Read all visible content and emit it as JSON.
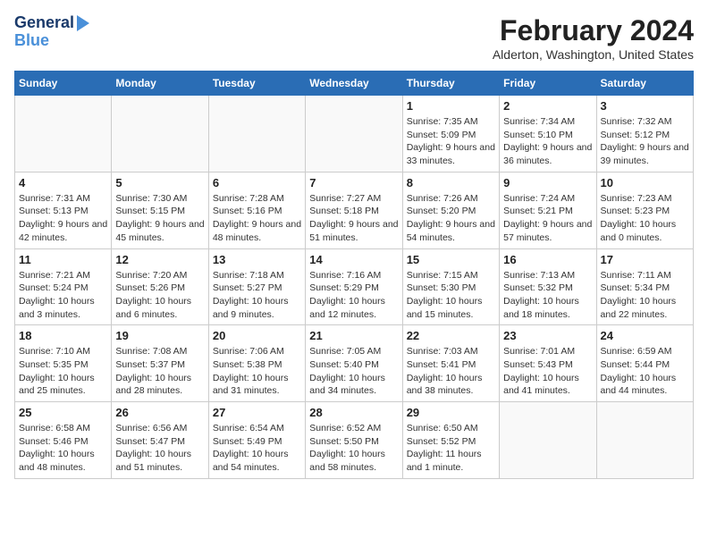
{
  "header": {
    "logo_line1": "General",
    "logo_line2": "Blue",
    "month": "February 2024",
    "location": "Alderton, Washington, United States"
  },
  "weekdays": [
    "Sunday",
    "Monday",
    "Tuesday",
    "Wednesday",
    "Thursday",
    "Friday",
    "Saturday"
  ],
  "weeks": [
    [
      {
        "day": "",
        "info": ""
      },
      {
        "day": "",
        "info": ""
      },
      {
        "day": "",
        "info": ""
      },
      {
        "day": "",
        "info": ""
      },
      {
        "day": "1",
        "info": "Sunrise: 7:35 AM\nSunset: 5:09 PM\nDaylight: 9 hours and 33 minutes."
      },
      {
        "day": "2",
        "info": "Sunrise: 7:34 AM\nSunset: 5:10 PM\nDaylight: 9 hours and 36 minutes."
      },
      {
        "day": "3",
        "info": "Sunrise: 7:32 AM\nSunset: 5:12 PM\nDaylight: 9 hours and 39 minutes."
      }
    ],
    [
      {
        "day": "4",
        "info": "Sunrise: 7:31 AM\nSunset: 5:13 PM\nDaylight: 9 hours and 42 minutes."
      },
      {
        "day": "5",
        "info": "Sunrise: 7:30 AM\nSunset: 5:15 PM\nDaylight: 9 hours and 45 minutes."
      },
      {
        "day": "6",
        "info": "Sunrise: 7:28 AM\nSunset: 5:16 PM\nDaylight: 9 hours and 48 minutes."
      },
      {
        "day": "7",
        "info": "Sunrise: 7:27 AM\nSunset: 5:18 PM\nDaylight: 9 hours and 51 minutes."
      },
      {
        "day": "8",
        "info": "Sunrise: 7:26 AM\nSunset: 5:20 PM\nDaylight: 9 hours and 54 minutes."
      },
      {
        "day": "9",
        "info": "Sunrise: 7:24 AM\nSunset: 5:21 PM\nDaylight: 9 hours and 57 minutes."
      },
      {
        "day": "10",
        "info": "Sunrise: 7:23 AM\nSunset: 5:23 PM\nDaylight: 10 hours and 0 minutes."
      }
    ],
    [
      {
        "day": "11",
        "info": "Sunrise: 7:21 AM\nSunset: 5:24 PM\nDaylight: 10 hours and 3 minutes."
      },
      {
        "day": "12",
        "info": "Sunrise: 7:20 AM\nSunset: 5:26 PM\nDaylight: 10 hours and 6 minutes."
      },
      {
        "day": "13",
        "info": "Sunrise: 7:18 AM\nSunset: 5:27 PM\nDaylight: 10 hours and 9 minutes."
      },
      {
        "day": "14",
        "info": "Sunrise: 7:16 AM\nSunset: 5:29 PM\nDaylight: 10 hours and 12 minutes."
      },
      {
        "day": "15",
        "info": "Sunrise: 7:15 AM\nSunset: 5:30 PM\nDaylight: 10 hours and 15 minutes."
      },
      {
        "day": "16",
        "info": "Sunrise: 7:13 AM\nSunset: 5:32 PM\nDaylight: 10 hours and 18 minutes."
      },
      {
        "day": "17",
        "info": "Sunrise: 7:11 AM\nSunset: 5:34 PM\nDaylight: 10 hours and 22 minutes."
      }
    ],
    [
      {
        "day": "18",
        "info": "Sunrise: 7:10 AM\nSunset: 5:35 PM\nDaylight: 10 hours and 25 minutes."
      },
      {
        "day": "19",
        "info": "Sunrise: 7:08 AM\nSunset: 5:37 PM\nDaylight: 10 hours and 28 minutes."
      },
      {
        "day": "20",
        "info": "Sunrise: 7:06 AM\nSunset: 5:38 PM\nDaylight: 10 hours and 31 minutes."
      },
      {
        "day": "21",
        "info": "Sunrise: 7:05 AM\nSunset: 5:40 PM\nDaylight: 10 hours and 34 minutes."
      },
      {
        "day": "22",
        "info": "Sunrise: 7:03 AM\nSunset: 5:41 PM\nDaylight: 10 hours and 38 minutes."
      },
      {
        "day": "23",
        "info": "Sunrise: 7:01 AM\nSunset: 5:43 PM\nDaylight: 10 hours and 41 minutes."
      },
      {
        "day": "24",
        "info": "Sunrise: 6:59 AM\nSunset: 5:44 PM\nDaylight: 10 hours and 44 minutes."
      }
    ],
    [
      {
        "day": "25",
        "info": "Sunrise: 6:58 AM\nSunset: 5:46 PM\nDaylight: 10 hours and 48 minutes."
      },
      {
        "day": "26",
        "info": "Sunrise: 6:56 AM\nSunset: 5:47 PM\nDaylight: 10 hours and 51 minutes."
      },
      {
        "day": "27",
        "info": "Sunrise: 6:54 AM\nSunset: 5:49 PM\nDaylight: 10 hours and 54 minutes."
      },
      {
        "day": "28",
        "info": "Sunrise: 6:52 AM\nSunset: 5:50 PM\nDaylight: 10 hours and 58 minutes."
      },
      {
        "day": "29",
        "info": "Sunrise: 6:50 AM\nSunset: 5:52 PM\nDaylight: 11 hours and 1 minute."
      },
      {
        "day": "",
        "info": ""
      },
      {
        "day": "",
        "info": ""
      }
    ]
  ]
}
